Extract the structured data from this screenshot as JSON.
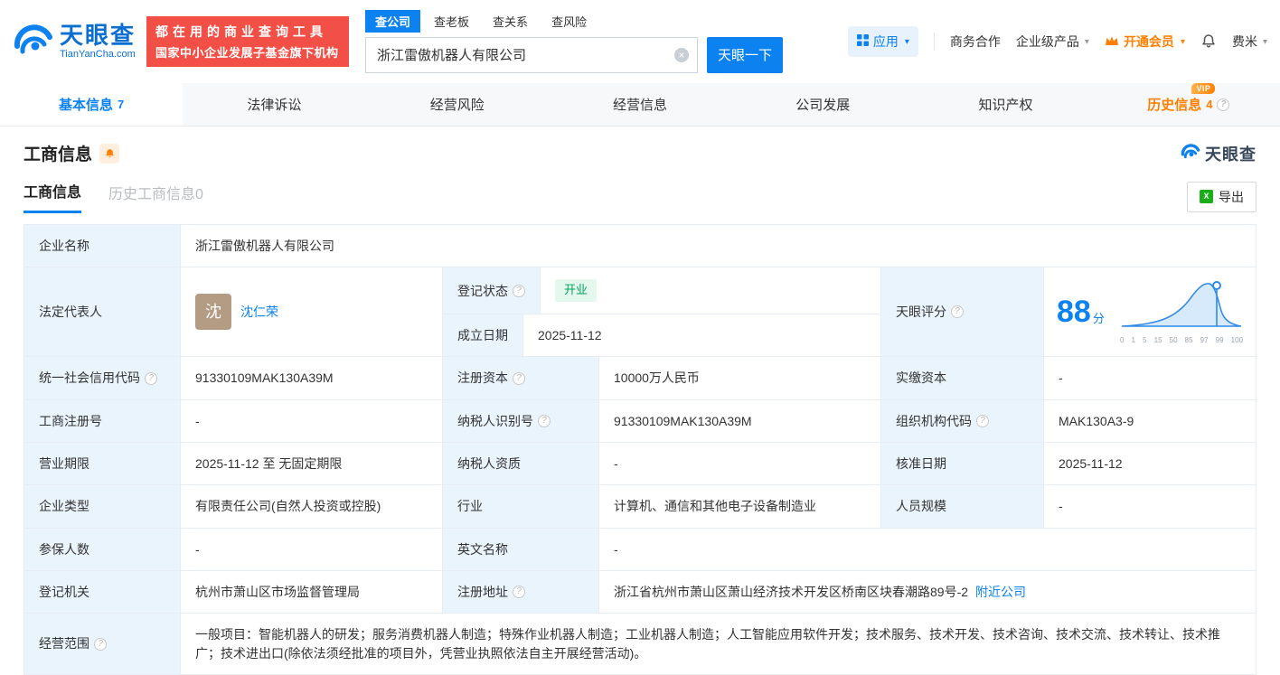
{
  "header": {
    "logo": {
      "title": "天眼查",
      "domain": "TianYanCha.com"
    },
    "promo": {
      "line1": "都在用的商业查询工具",
      "line2": "国家中小企业发展子基金旗下机构"
    },
    "search": {
      "tabs": [
        {
          "label": "查公司"
        },
        {
          "label": "查老板"
        },
        {
          "label": "查关系"
        },
        {
          "label": "查风险"
        }
      ],
      "value": "浙江雷傲机器人有限公司",
      "button": "天眼一下"
    },
    "menu": {
      "apps": "应用",
      "cooperation": "商务合作",
      "enterprise": "企业级产品",
      "vip": "开通会员",
      "user": "费米"
    }
  },
  "nav": {
    "tabs": [
      {
        "label": "基本信息",
        "count": "7"
      },
      {
        "label": "法律诉讼",
        "count": ""
      },
      {
        "label": "经营风险",
        "count": ""
      },
      {
        "label": "经营信息",
        "count": ""
      },
      {
        "label": "公司发展",
        "count": ""
      },
      {
        "label": "知识产权",
        "count": ""
      },
      {
        "label": "历史信息",
        "count": "4",
        "badge": "VIP"
      }
    ]
  },
  "section": {
    "title": "工商信息",
    "brand": "天眼查",
    "tabs": [
      {
        "label": "工商信息"
      },
      {
        "label": "历史工商信息0"
      }
    ],
    "export": "导出"
  },
  "score": {
    "value": "88",
    "unit": "分",
    "ticks": [
      "0",
      "1",
      "5",
      "15",
      "50",
      "85",
      "97",
      "99",
      "100"
    ]
  },
  "fields": {
    "company_name": {
      "label": "企业名称",
      "value": "浙江雷傲机器人有限公司"
    },
    "legal_rep": {
      "label": "法定代表人",
      "avatar": "沈",
      "value": "沈仁荣"
    },
    "reg_status": {
      "label": "登记状态",
      "value": "开业"
    },
    "establish_date": {
      "label": "成立日期",
      "value": "2025-11-12"
    },
    "score_label": {
      "label": "天眼评分"
    },
    "credit_code": {
      "label": "统一社会信用代码",
      "value": "91330109MAK130A39M"
    },
    "reg_capital": {
      "label": "注册资本",
      "value": "10000万人民币"
    },
    "paid_capital": {
      "label": "实缴资本",
      "value": "-"
    },
    "reg_number": {
      "label": "工商注册号",
      "value": "-"
    },
    "taxpayer_id": {
      "label": "纳税人识别号",
      "value": "91330109MAK130A39M"
    },
    "org_code": {
      "label": "组织机构代码",
      "value": "MAK130A3-9"
    },
    "business_term": {
      "label": "营业期限",
      "value": "2025-11-12 至 无固定期限"
    },
    "taxpayer_quality": {
      "label": "纳税人资质",
      "value": "-"
    },
    "approval_date": {
      "label": "核准日期",
      "value": "2025-11-12"
    },
    "company_type": {
      "label": "企业类型",
      "value": "有限责任公司(自然人投资或控股)"
    },
    "industry": {
      "label": "行业",
      "value": "计算机、通信和其他电子设备制造业"
    },
    "staff_size": {
      "label": "人员规模",
      "value": "-"
    },
    "insured_count": {
      "label": "参保人数",
      "value": "-"
    },
    "english_name": {
      "label": "英文名称",
      "value": "-"
    },
    "reg_authority": {
      "label": "登记机关",
      "value": "杭州市萧山区市场监督管理局"
    },
    "reg_address": {
      "label": "注册地址",
      "value": "浙江省杭州市萧山区萧山经济技术开发区桥南区块春潮路89号-2",
      "link": "附近公司"
    },
    "business_scope": {
      "label": "经营范围",
      "value": "一般项目：智能机器人的研发；服务消费机器人制造；特殊作业机器人制造；工业机器人制造；人工智能应用软件开发；技术服务、技术开发、技术咨询、技术交流、技术转让、技术推广；技术进出口(除依法须经批准的项目外，凭营业执照依法自主开展经营活动)。"
    }
  }
}
